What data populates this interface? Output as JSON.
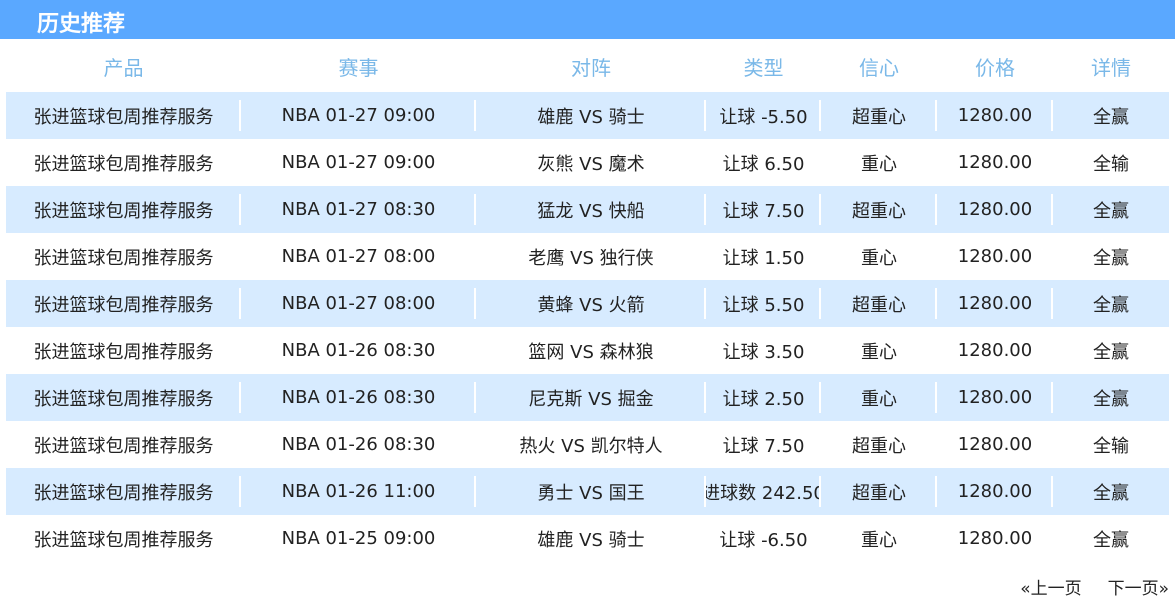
{
  "title": "历史推荐",
  "columns": [
    "产品",
    "赛事",
    "对阵",
    "类型",
    "信心",
    "价格",
    "详情"
  ],
  "rows": [
    [
      "张进篮球包周推荐服务",
      "NBA 01-27 09:00",
      "雄鹿 VS 骑士",
      "让球 -5.50",
      "超重心",
      "1280.00",
      "全赢"
    ],
    [
      "张进篮球包周推荐服务",
      "NBA 01-27 09:00",
      "灰熊 VS 魔术",
      "让球 6.50",
      "重心",
      "1280.00",
      "全输"
    ],
    [
      "张进篮球包周推荐服务",
      "NBA 01-27 08:30",
      "猛龙 VS 快船",
      "让球 7.50",
      "超重心",
      "1280.00",
      "全赢"
    ],
    [
      "张进篮球包周推荐服务",
      "NBA 01-27 08:00",
      "老鹰 VS 独行侠",
      "让球 1.50",
      "重心",
      "1280.00",
      "全赢"
    ],
    [
      "张进篮球包周推荐服务",
      "NBA 01-27 08:00",
      "黄蜂 VS 火箭",
      "让球 5.50",
      "超重心",
      "1280.00",
      "全赢"
    ],
    [
      "张进篮球包周推荐服务",
      "NBA 01-26 08:30",
      "篮网 VS 森林狼",
      "让球 3.50",
      "重心",
      "1280.00",
      "全赢"
    ],
    [
      "张进篮球包周推荐服务",
      "NBA 01-26 08:30",
      "尼克斯 VS 掘金",
      "让球 2.50",
      "重心",
      "1280.00",
      "全赢"
    ],
    [
      "张进篮球包周推荐服务",
      "NBA 01-26 08:30",
      "热火 VS 凯尔特人",
      "让球 7.50",
      "超重心",
      "1280.00",
      "全输"
    ],
    [
      "张进篮球包周推荐服务",
      "NBA 01-26 11:00",
      "勇士 VS 国王",
      "进球数 242.50",
      "超重心",
      "1280.00",
      "全赢"
    ],
    [
      "张进篮球包周推荐服务",
      "NBA 01-25 09:00",
      "雄鹿 VS 骑士",
      "让球 -6.50",
      "重心",
      "1280.00",
      "全赢"
    ]
  ],
  "pager": {
    "prev": "«上一页",
    "next": "下一页»"
  },
  "colors": {
    "accent": "#5aa8ff",
    "header_text": "#7ab8e8",
    "row_alt": "#d7ebff"
  }
}
